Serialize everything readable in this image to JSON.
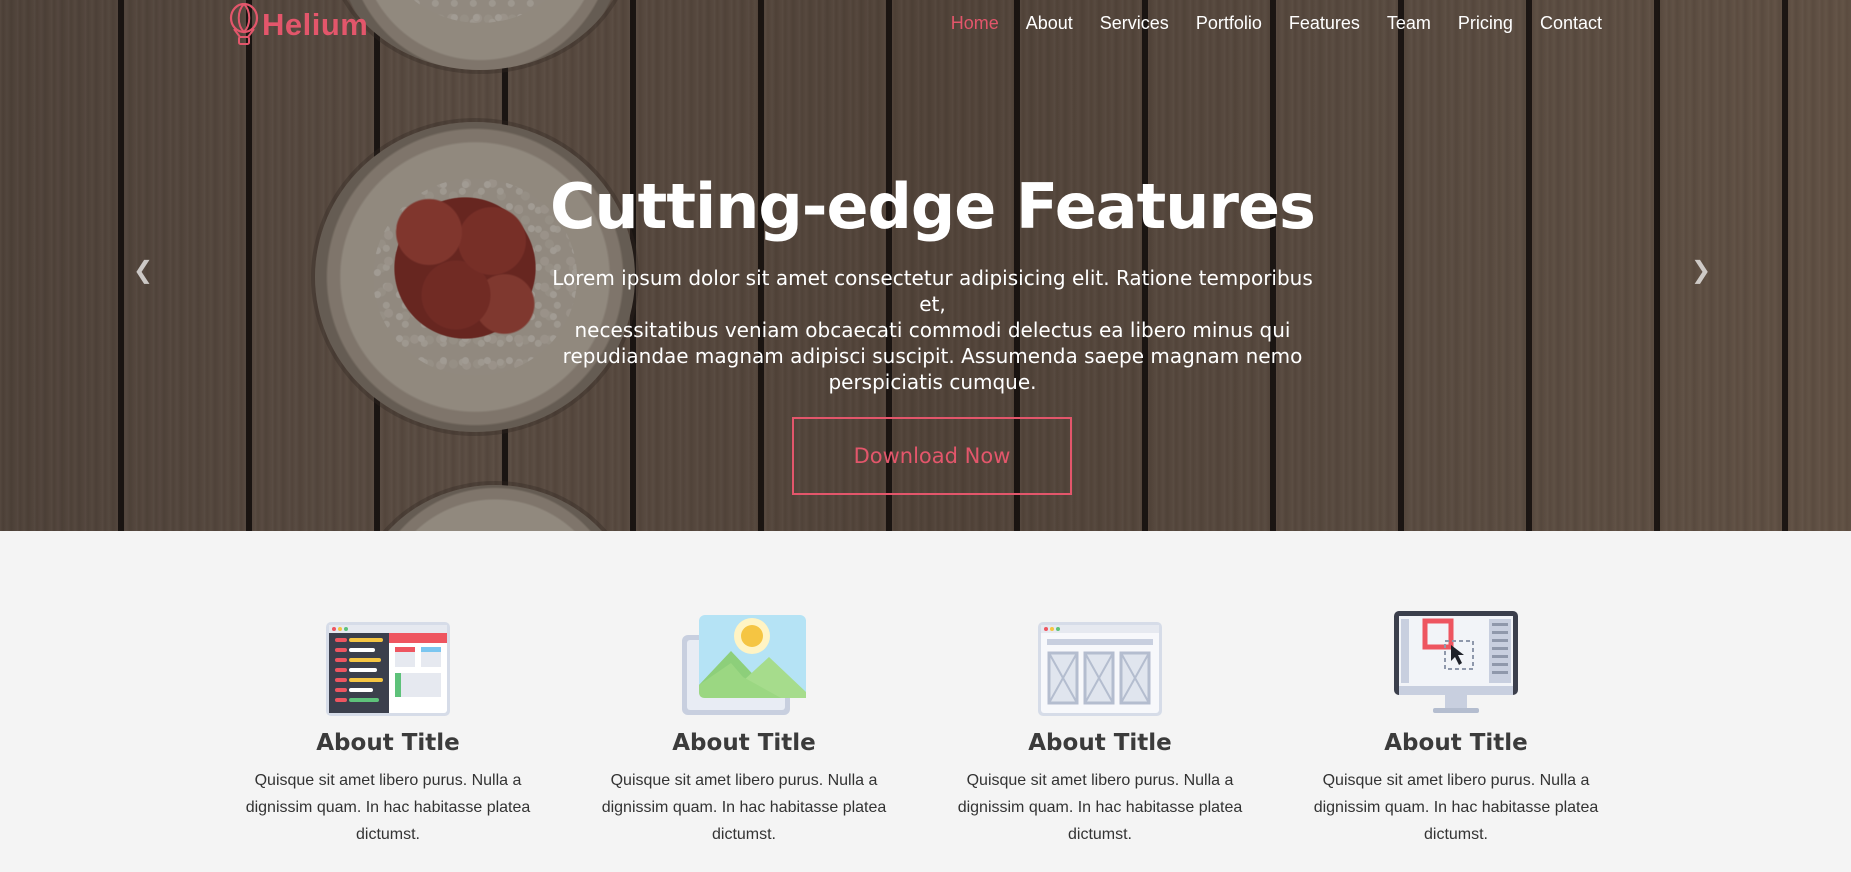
{
  "brand": {
    "name": "Helium",
    "logo_icon": "hot-air-balloon-icon",
    "accent": "#e3566b"
  },
  "nav": {
    "items": [
      {
        "label": "Home",
        "active": true
      },
      {
        "label": "About"
      },
      {
        "label": "Services"
      },
      {
        "label": "Portfolio"
      },
      {
        "label": "Features"
      },
      {
        "label": "Team"
      },
      {
        "label": "Pricing"
      },
      {
        "label": "Contact"
      }
    ]
  },
  "hero": {
    "title": "Cutting-edge Features",
    "text_lines": [
      "Lorem ipsum dolor sit amet consectetur adipisicing elit. Ratione temporibus et,",
      "necessitatibus veniam obcaecati commodi delectus ea libero minus qui",
      "repudiandae magnam adipisci suscipit. Assumenda saepe magnam nemo",
      "perspiciatis cumque."
    ],
    "button_label": "Download Now",
    "prev_icon": "chevron-left-icon",
    "next_icon": "chevron-right-icon"
  },
  "features": [
    {
      "icon": "code-editor-icon",
      "title": "About Title",
      "text_lines": [
        "Quisque sit amet libero purus. Nulla a",
        "dignissim quam. In hac habitasse platea",
        "dictumst."
      ]
    },
    {
      "icon": "image-gallery-icon",
      "title": "About Title",
      "text_lines": [
        "Quisque sit amet libero purus. Nulla a",
        "dignissim quam. In hac habitasse platea",
        "dictumst."
      ]
    },
    {
      "icon": "wireframe-layout-icon",
      "title": "About Title",
      "text_lines": [
        "Quisque sit amet libero purus. Nulla a",
        "dignissim quam. In hac habitasse platea",
        "dictumst."
      ]
    },
    {
      "icon": "design-monitor-icon",
      "title": "About Title",
      "text_lines": [
        "Quisque sit amet libero purus. Nulla a",
        "dignissim quam. In hac habitasse platea",
        "dictumst."
      ]
    }
  ]
}
